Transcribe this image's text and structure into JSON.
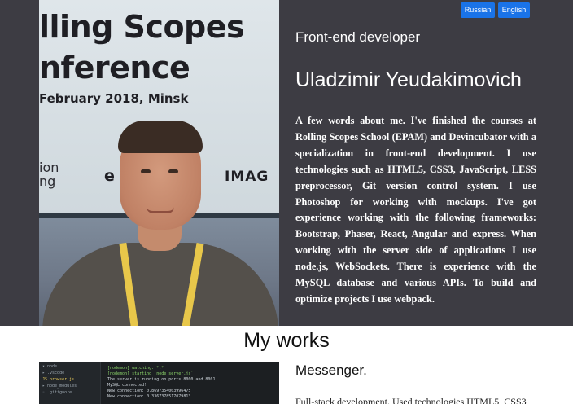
{
  "header": {
    "banner": {
      "line1": "lling Scopes",
      "line2": "nference",
      "line3": "February 2018, Minsk",
      "line4a": "ion",
      "line4b": "ng",
      "sponsor_mid": "e",
      "sponsor_right": "IMAG"
    },
    "lang_buttons": {
      "russian": "Russian",
      "english": "English"
    },
    "job_title": "Front-end developer",
    "name": "Uladzimir Yeudakimovich",
    "about": "A few words about me. I've finished the courses at Rolling Scopes School (EPAM) and Devincubator with a specialization in front-end development. I use technologies such as HTML5, CSS3, JavaScript, LESS preprocessor, Git version control system. I use Photoshop for working with mockups. I've got experience working with the following frameworks: Bootstrap, Phaser, React, Angular and express. When working with the server side of applications I use node.js, WebSockets. There is experience with the MySQL database and various APIs. To build and optimize projects I use webpack."
  },
  "works": {
    "title": "My works",
    "projects": [
      {
        "title": "Messenger.",
        "description": "Full-stack development. Used technologies HTML5, CSS3,",
        "screenshot": {
          "sidebar_lines": [
            "▾ node",
            "  ▸ .vscode",
            "  JS browser.js",
            "  ▸ node_modules",
            "  ◦ .gitignore"
          ],
          "terminal_lines": [
            "[nodemon] watching: *.*",
            "[nodemon] starting `node server.js`",
            "The server is running on ports 8000 and 8001",
            "MySQL connected!",
            "New connection: 0.8697354003996475",
            "New connection: 0.3367378517079813"
          ]
        }
      }
    ]
  },
  "colors": {
    "header_bg": "#3d3c43",
    "button_blue": "#1a73e8",
    "terminal_green": "#8bd46a"
  }
}
